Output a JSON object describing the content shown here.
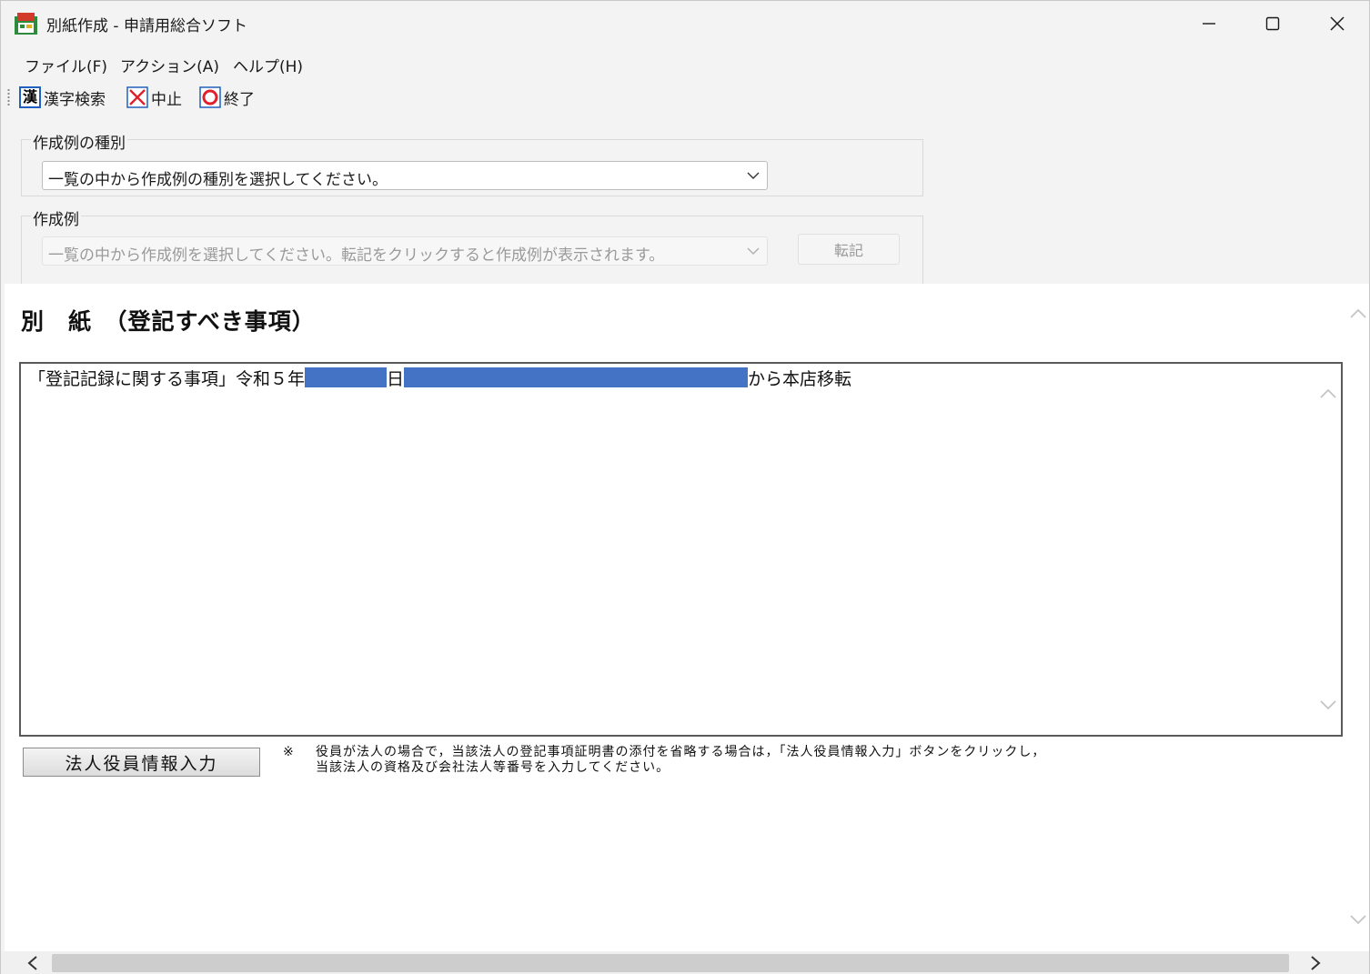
{
  "window": {
    "title": "別紙作成 - 申請用総合ソフト"
  },
  "menu": {
    "file": "ファイル(F)",
    "action": "アクション(A)",
    "help": "ヘルプ(H)"
  },
  "toolbar": {
    "kanji_icon_glyph": "漢",
    "kanji_search": "漢字検索",
    "cancel": "中止",
    "exit": "終了"
  },
  "example_type_group": {
    "title": "作成例の種別",
    "selected": "一覧の中から作成例の種別を選択してください。"
  },
  "example_group": {
    "title": "作成例",
    "selected": "一覧の中から作成例を選択してください。転記をクリックすると作成例が表示されます。",
    "transfer_button": "転記"
  },
  "document": {
    "heading": "別　紙　（登記すべき事項）",
    "line_prefix": "「登記記録に関する事項」令和５年",
    "line_mid": "日",
    "line_suffix": "から本店移転"
  },
  "corporate_officer_button": "法人役員情報入力",
  "note": {
    "mark": "※",
    "line1": "役員が法人の場合で，当該法人の登記事項証明書の添付を省略する場合は，「法人役員情報入力」ボタンをクリックし，",
    "line2": "当該法人の資格及び会社法人等番号を入力してください。"
  },
  "colors": {
    "redaction": "#4472c4",
    "cancel_icon": "#e0202a",
    "exit_icon": "#e0202a",
    "kanji_icon_border": "#2060c0"
  }
}
